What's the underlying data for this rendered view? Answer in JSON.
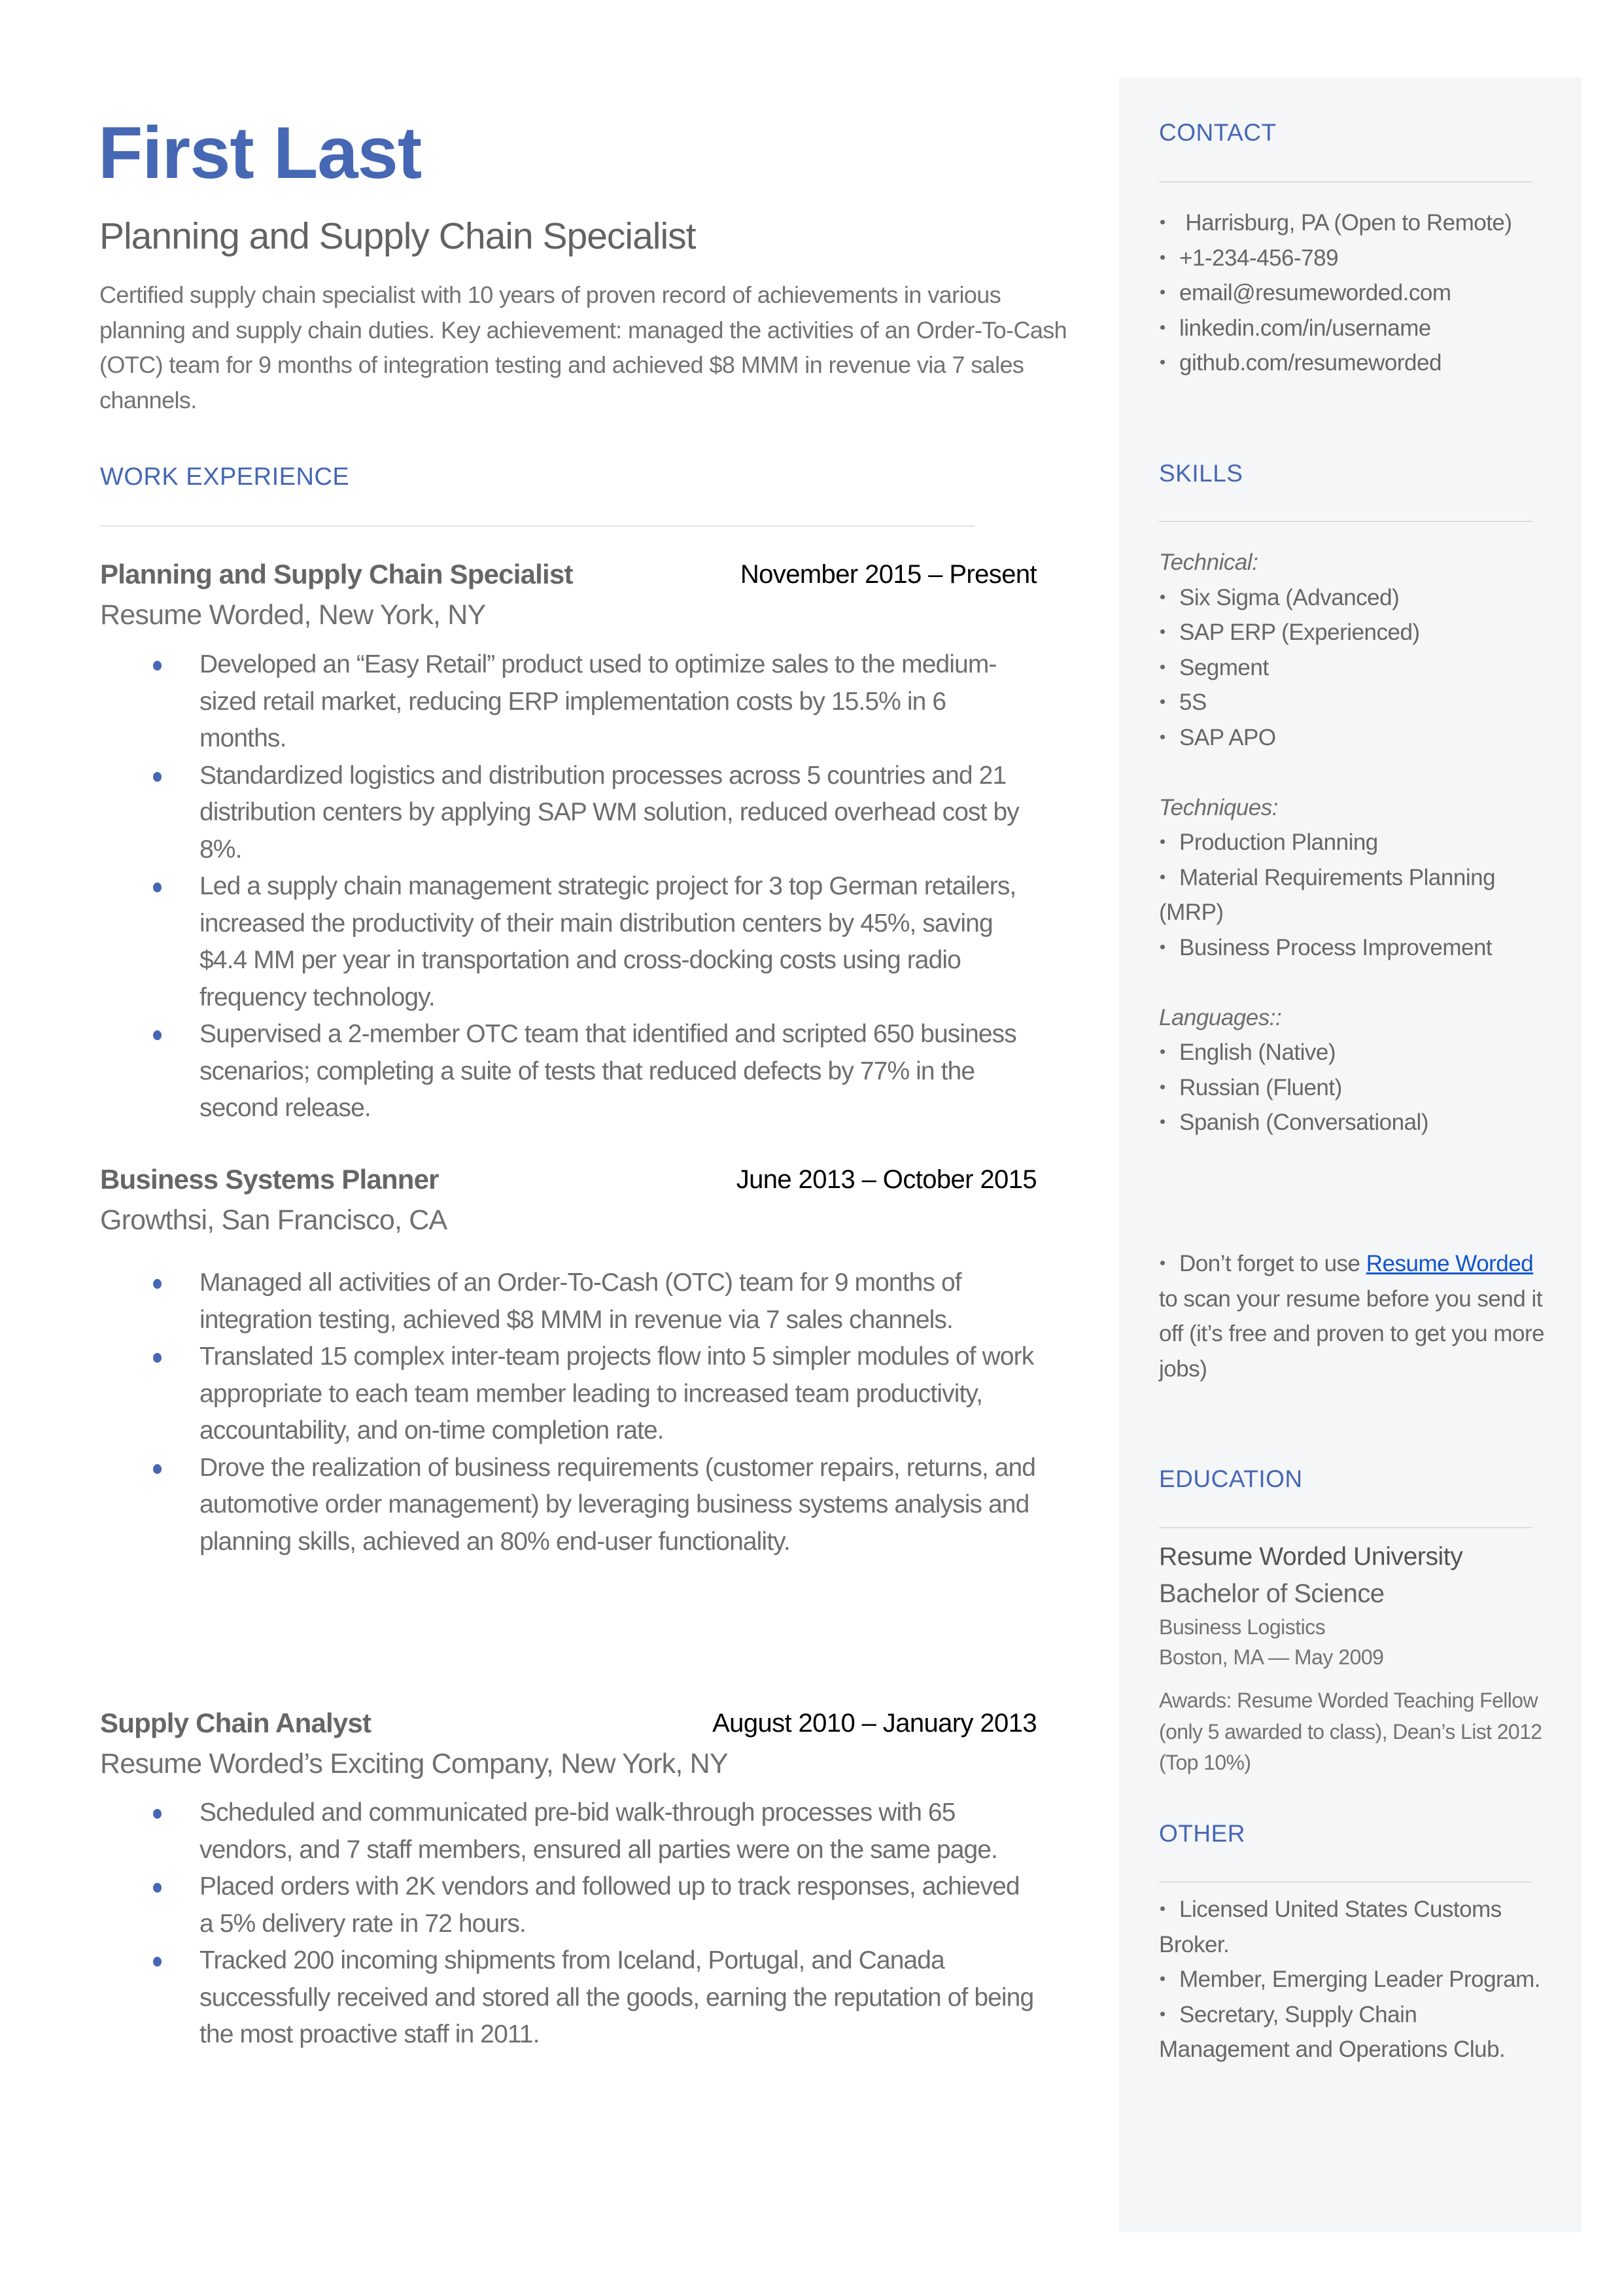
{
  "header": {
    "name": "First Last",
    "title": "Planning and Supply Chain Specialist",
    "summary": "Certified supply chain specialist with 10 years of proven record of achievements in various planning and supply chain duties. Key achievement: managed the activities of an Order-To-Cash (OTC) team for 9 months of integration testing and achieved $8 MMM in revenue via 7 sales channels."
  },
  "colors": {
    "accent": "#4567b4",
    "sidebar_bg": "#f5f6f8",
    "link": "#1155cc",
    "body_text": "#666666"
  },
  "work": {
    "heading": "WORK EXPERIENCE",
    "jobs": [
      {
        "title": "Planning and Supply Chain Specialist",
        "dates": "November 2015 – Present",
        "company": "Resume Worded, New York, NY",
        "bullets": [
          "Developed an “Easy Retail” product used to optimize sales to the medium-sized retail market, reducing ERP implementation costs by 15.5% in 6 months.",
          "Standardized logistics and distribution processes across 5 countries and 21 distribution centers by applying SAP WM solution, reduced overhead cost by 8%.",
          "Led a supply chain management strategic project for 3 top German retailers, increased the productivity of their main distribution centers by 45%, saving $4.4 MM per year in transportation and cross-docking costs using radio frequency technology.",
          "Supervised a 2-member OTC team that identified and scripted 650 business scenarios; completing a suite of tests that reduced defects by 77% in the second release."
        ]
      },
      {
        "title": "Business Systems Planner",
        "dates": "June 2013 – October 2015",
        "company": "Growthsi, San Francisco, CA",
        "bullets": [
          "Managed all activities of an Order-To-Cash (OTC) team for 9 months of integration testing, achieved $8 MMM in revenue via 7 sales channels.",
          "Translated 15 complex inter-team projects flow into 5 simpler modules of work appropriate to each team member leading to increased team productivity, accountability, and on-time completion rate.",
          "Drove the realization of business requirements (customer repairs, returns, and automotive order management) by leveraging business systems analysis and planning skills, achieved an 80% end-user functionality."
        ]
      },
      {
        "title": "Supply Chain Analyst",
        "dates": "August 2010 – January 2013",
        "company": "Resume Worded’s Exciting Company, New York, NY",
        "bullets": [
          "Scheduled and communicated pre-bid walk-through processes with 65 vendors, and 7 staff members, ensured all parties were on the same page.",
          "Placed orders with 2K vendors and followed up to track responses, achieved a 5% delivery rate in 72 hours.",
          "Tracked 200 incoming shipments from Iceland, Portugal, and Canada successfully received and stored all the goods, earning the reputation of being the most proactive staff in 2011."
        ]
      }
    ]
  },
  "sidebar": {
    "contact": {
      "heading": "CONTACT",
      "items": [
        " Harrisburg, PA (Open to Remote)",
        "+1-234-456-789",
        "email@resumeworded.com",
        "linkedin.com/in/username",
        "github.com/resumeworded"
      ]
    },
    "skills": {
      "heading": "SKILLS",
      "technical_label": "Technical:",
      "technical": [
        "Six Sigma (Advanced)",
        "SAP ERP (Experienced)",
        "Segment",
        "5S",
        "SAP APO"
      ],
      "techniques_label": "Techniques:",
      "techniques": [
        "Production Planning",
        "Material Requirements Planning (MRP)",
        "Business Process Improvement"
      ],
      "languages_label": "Languages::",
      "languages": [
        "English (Native)",
        "Russian (Fluent)",
        "Spanish (Conversational)"
      ]
    },
    "tip": {
      "before": "Don’t forget to use ",
      "link_text": "Resume Worded",
      "after": " to scan your resume before you send it off (it’s free and proven to get you more jobs)"
    },
    "education": {
      "heading": "EDUCATION",
      "school": "Resume Worded University",
      "degree": "Bachelor of Science",
      "field": "Business Logistics",
      "location_date": "Boston, MA — May 2009",
      "awards": "Awards: Resume Worded Teaching Fellow (only 5 awarded to class), Dean’s List 2012 (Top 10%)"
    },
    "other": {
      "heading": "OTHER",
      "items": [
        "Licensed United States Customs Broker.",
        "Member, Emerging Leader Program.",
        "Secretary, Supply Chain Management and Operations Club."
      ]
    }
  }
}
